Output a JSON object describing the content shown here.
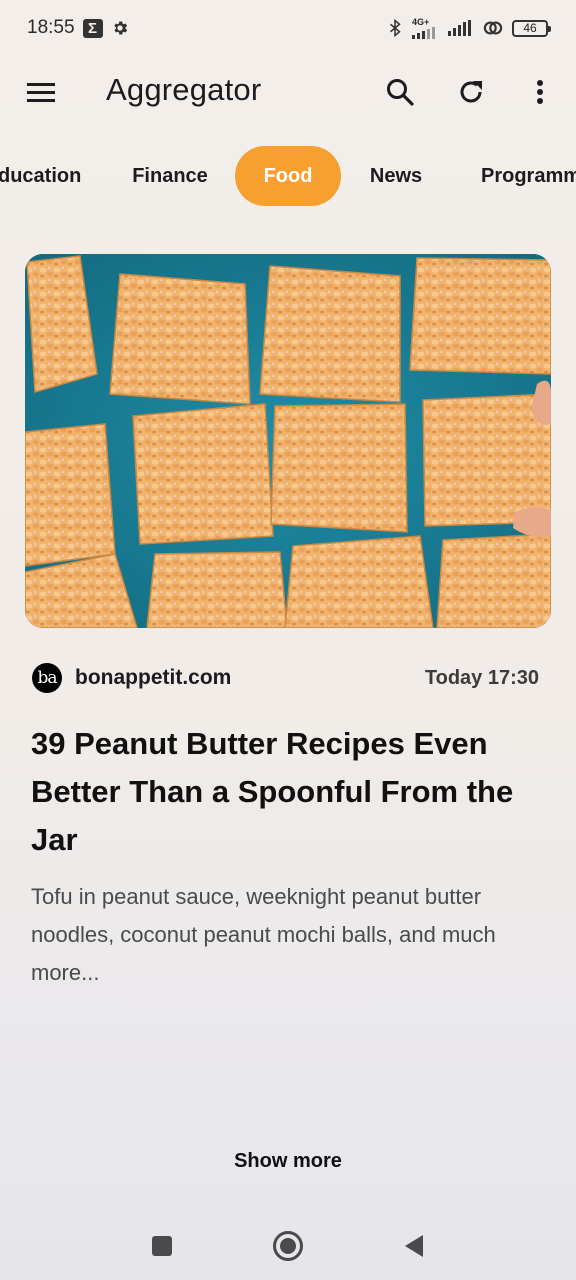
{
  "status_bar": {
    "time": "18:55",
    "network_label": "4G+",
    "battery": "46",
    "icons": [
      "sigma-icon",
      "settings-gear-icon",
      "bluetooth-icon",
      "signal-icon",
      "signal-icon",
      "link-icon",
      "battery-icon"
    ]
  },
  "app_bar": {
    "title": "Aggregator",
    "icons": [
      "menu-icon",
      "search-icon",
      "refresh-icon",
      "more-vert-icon"
    ]
  },
  "tabs": [
    {
      "label": "Education",
      "visible_text": "ducation"
    },
    {
      "label": "Finance"
    },
    {
      "label": "Food",
      "active": true
    },
    {
      "label": "News"
    },
    {
      "label": "Programm"
    }
  ],
  "article": {
    "source_logo_text": "ba",
    "source": "bonappetit.com",
    "timestamp": "Today 17:30",
    "title": "39 Peanut Butter Recipes Even Better Than a Spoonful From the Jar",
    "summary": "Tofu in peanut sauce, weeknight peanut butter noodles, coconut peanut mochi balls, and much more..."
  },
  "show_more_label": "Show more",
  "nav_bar": {
    "icons": [
      "recents-square-icon",
      "home-circle-icon",
      "back-triangle-icon"
    ]
  },
  "colors": {
    "accent": "#f7a030",
    "background": "#f3eeea",
    "hero_background": "#1a7d95"
  }
}
